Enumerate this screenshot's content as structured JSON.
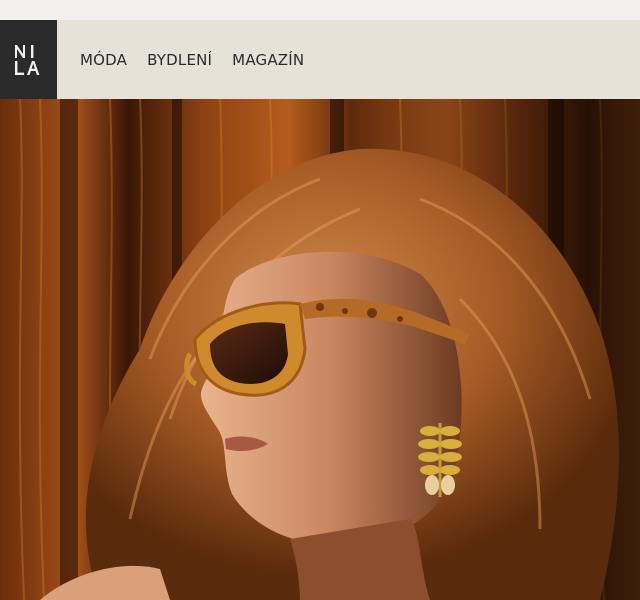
{
  "logo": {
    "text": "NILA"
  },
  "nav": {
    "items": [
      {
        "label": "MÓDA"
      },
      {
        "label": "BYDLENÍ"
      },
      {
        "label": "MAGAZÍN"
      }
    ]
  },
  "colors": {
    "header_bg": "#e6e2d8",
    "logo_bg": "#2a2a2a",
    "page_bg": "#f2f0ec",
    "text": "#2b2b2b"
  }
}
